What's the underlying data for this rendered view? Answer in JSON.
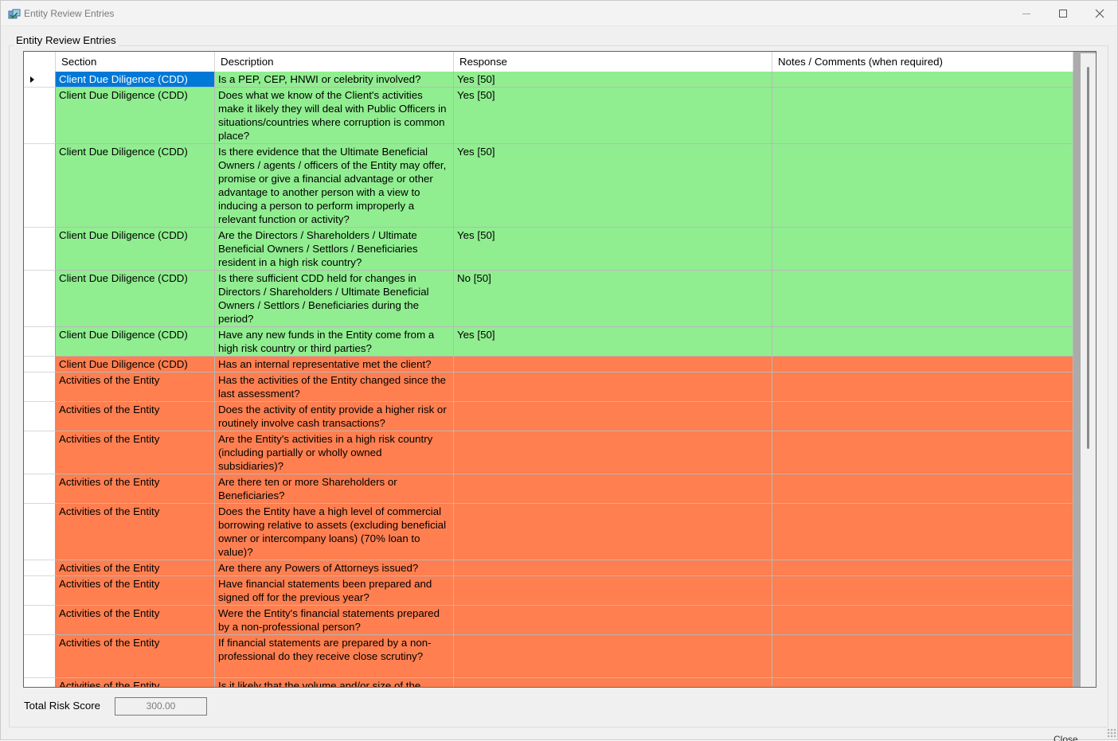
{
  "window": {
    "title": "Entity Review Entries"
  },
  "groupbox": {
    "label": "Entity Review Entries"
  },
  "grid": {
    "columns": [
      "Section",
      "Description",
      "Response",
      "Notes / Comments (when required)"
    ],
    "rows": [
      {
        "section": "Client Due Diligence (CDD)",
        "description": "Is a PEP, CEP, HNWI or celebrity involved?",
        "response": "Yes [50]",
        "notes": "",
        "status": "green",
        "height": 20,
        "selected": true
      },
      {
        "section": "Client Due Diligence (CDD)",
        "description": "Does what we know of the Client's activities make it likely they will deal with Public Officers in situations/countries where corruption is common place?",
        "response": "Yes [50]",
        "notes": "",
        "status": "green",
        "height": 71,
        "selected": false
      },
      {
        "section": "Client Due Diligence (CDD)",
        "description": "Is there evidence that the Ultimate Beneficial Owners / agents / officers of the Entity may offer, promise or give a financial advantage or other advantage to another person with a view to inducing a person to perform improperly a relevant function or activity?",
        "response": "Yes [50]",
        "notes": "",
        "status": "green",
        "height": 105,
        "selected": false
      },
      {
        "section": "Client Due Diligence (CDD)",
        "description": "Are the Directors / Shareholders / Ultimate Beneficial Owners / Settlors / Beneficiaries resident in a high risk country?",
        "response": "Yes [50]",
        "notes": "",
        "status": "green",
        "height": 54,
        "selected": false
      },
      {
        "section": "Client Due Diligence (CDD)",
        "description": "Is there sufficient CDD held for changes in Directors / Shareholders / Ultimate Beneficial Owners / Settlors / Beneficiaries during the period?",
        "response": "No [50]",
        "notes": "",
        "status": "green",
        "height": 71,
        "selected": false
      },
      {
        "section": "Client Due Diligence (CDD)",
        "description": "Have any new funds in the Entity come from a high risk country or third parties?",
        "response": "Yes [50]",
        "notes": "",
        "status": "green",
        "height": 37,
        "selected": false
      },
      {
        "section": "Client Due Diligence (CDD)",
        "description": "Has an internal representative met the client?",
        "response": "",
        "notes": "",
        "status": "orange",
        "height": 20,
        "selected": false
      },
      {
        "section": "Activities of the Entity",
        "description": "Has the activities of the Entity changed since the last assessment?",
        "response": "",
        "notes": "",
        "status": "orange",
        "height": 37,
        "selected": false
      },
      {
        "section": "Activities of the Entity",
        "description": "Does the activity of entity provide a higher risk or routinely involve cash transactions?",
        "response": "",
        "notes": "",
        "status": "orange",
        "height": 37,
        "selected": false
      },
      {
        "section": "Activities of the Entity",
        "description": "Are the Entity's activities in a high risk country (including partially or wholly owned subsidiaries)?",
        "response": "",
        "notes": "",
        "status": "orange",
        "height": 54,
        "selected": false
      },
      {
        "section": "Activities of the Entity",
        "description": "Are there ten or more Shareholders or Beneficiaries?",
        "response": "",
        "notes": "",
        "status": "orange",
        "height": 37,
        "selected": false
      },
      {
        "section": "Activities of the Entity",
        "description": "Does the Entity have a high level of commercial borrowing relative to assets (excluding beneficial owner or intercompany loans) (70% loan to value)?",
        "response": "",
        "notes": "",
        "status": "orange",
        "height": 71,
        "selected": false
      },
      {
        "section": "Activities of the Entity",
        "description": "Are there any Powers of Attorneys issued?",
        "response": "",
        "notes": "",
        "status": "orange",
        "height": 20,
        "selected": false
      },
      {
        "section": "Activities of the Entity",
        "description": "Have financial statements been prepared and signed off for the previous year?",
        "response": "",
        "notes": "",
        "status": "orange",
        "height": 37,
        "selected": false
      },
      {
        "section": "Activities of the Entity",
        "description": "Were the Entity's financial statements prepared by a non-professional person?",
        "response": "",
        "notes": "",
        "status": "orange",
        "height": 37,
        "selected": false
      },
      {
        "section": "Activities of the Entity",
        "description": "If financial statements are prepared by a non-professional do they receive close scrutiny?",
        "response": "",
        "notes": "",
        "status": "orange",
        "height": 54,
        "selected": false
      },
      {
        "section": "Activities of the Entity",
        "description": "Is it likely that the volume and/or size of the",
        "response": "",
        "notes": "",
        "status": "orange",
        "height": 37,
        "selected": false
      }
    ]
  },
  "footer": {
    "total_label": "Total Risk Score",
    "total_value": "300.00",
    "close_label": "Close"
  },
  "colors": {
    "green": "#90ee90",
    "orange": "#ff7f50",
    "selected": "#0078d7"
  }
}
